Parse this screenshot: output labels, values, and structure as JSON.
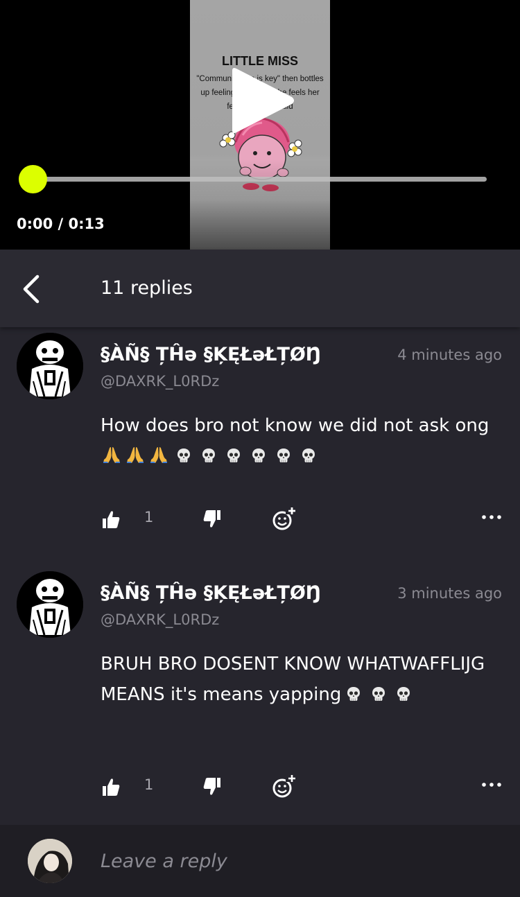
{
  "video": {
    "thumbnail": {
      "title": "LITTLE MISS",
      "caption": "\"Communication is key\" then bottles up feelings because she feels her feelings are invalid"
    },
    "time_display": "0:00 / 0:13",
    "progress": 0.0,
    "accent_color": "#dcff00",
    "play_icon": "play-icon"
  },
  "replies_header": {
    "title": "11 replies",
    "back_icon": "chevron-left-icon"
  },
  "comments": [
    {
      "username": "§ÀÑ§ ȚĤә §ĶĘŁәŁȚØŊ",
      "handle": "@DAXRK_L0RDz",
      "timestamp": "4 minutes ago",
      "text_main": "How does bro not know we did not ask ong",
      "emoji": [
        "pray",
        "pray",
        "pray",
        "skull",
        "skull",
        "skull",
        "skull",
        "skull",
        "skull"
      ],
      "likes": "1"
    },
    {
      "username": "§ÀÑ§ ȚĤә §ĶĘŁәŁȚØŊ",
      "handle": "@DAXRK_L0RDz",
      "timestamp": "3 minutes ago",
      "text_main": "BRUH BRO DOSENT KNOW WHATWAFFLIJG MEANS it's means yapping",
      "emoji": [
        "skull",
        "skull",
        "skull"
      ],
      "likes": "1"
    }
  ],
  "reply_bar": {
    "placeholder": "Leave a reply"
  }
}
